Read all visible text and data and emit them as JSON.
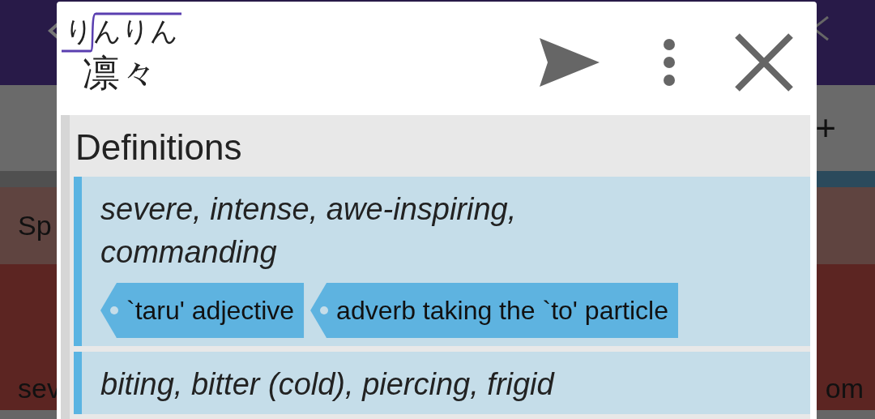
{
  "background": {
    "entry_bar": {
      "button": "+"
    },
    "rows": [
      {
        "text_left": "Sp"
      },
      {
        "text_left": "sev",
        "text_right": "om"
      }
    ]
  },
  "popup": {
    "reading": "りんりん",
    "pitch_high": [
      false,
      true,
      true,
      true
    ],
    "word": "凛々",
    "section_title": "Definitions",
    "definitions": [
      {
        "lines": [
          "severe, intense, awe-inspiring,",
          "commanding"
        ],
        "tags": [
          "`taru' adjective",
          "adverb taking the `to' particle"
        ]
      },
      {
        "lines": [
          "biting, bitter (cold), piercing, frigid"
        ]
      }
    ]
  }
}
